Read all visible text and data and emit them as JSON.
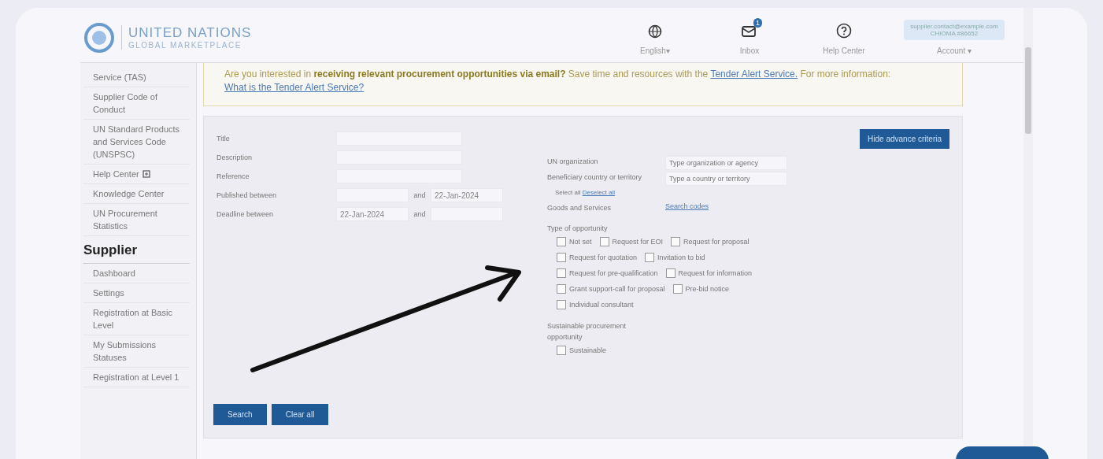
{
  "header": {
    "logo_title": "UNITED NATIONS",
    "logo_subtitle": "GLOBAL MARKETPLACE",
    "nav": [
      {
        "kind": "globe",
        "label": "English",
        "caret": "▾"
      },
      {
        "kind": "inbox",
        "label": "Inbox",
        "badge": "1"
      },
      {
        "kind": "help",
        "label": "Help Center"
      }
    ],
    "account": {
      "lines": [
        "supplier.contact@example.com",
        "CHIOMA #86652"
      ],
      "label": "Account",
      "caret": "▾"
    }
  },
  "sidebar": {
    "items": [
      {
        "label": "Service (TAS)",
        "kind": "link"
      },
      {
        "label": "Supplier Code of Conduct",
        "kind": "link"
      },
      {
        "label": "UN Standard Products and Services Code (UNSPSC)",
        "kind": "link"
      },
      {
        "label": "Help Center",
        "kind": "external"
      },
      {
        "label": "Knowledge Center",
        "kind": "link"
      },
      {
        "label": "UN Procurement Statistics",
        "kind": "link"
      },
      {
        "label": "Supplier",
        "kind": "heading"
      },
      {
        "label": "Dashboard",
        "kind": "link"
      },
      {
        "label": "Settings",
        "kind": "link"
      },
      {
        "label": "Registration at Basic Level",
        "kind": "link"
      },
      {
        "label": "My Submissions Statuses",
        "kind": "link"
      },
      {
        "label": "Registration at Level 1",
        "kind": "link"
      }
    ]
  },
  "banner": {
    "text": "Are you interested in **receiving relevant procurement opportunities via email?** Save time and resources with the",
    "link": "Tender Alert Service.",
    "after": "For more information:",
    "link2": "What is the Tender Alert Service?"
  },
  "form": {
    "fields": [
      {
        "label": "Title",
        "kind": "text"
      },
      {
        "label": "Description",
        "kind": "text"
      },
      {
        "label": "Reference",
        "kind": "text"
      },
      {
        "label": "Published between",
        "kind": "range",
        "and": "and",
        "to": "22-Jan-2024"
      },
      {
        "label": "Deadline between",
        "kind": "range",
        "from": "22-Jan-2024",
        "and": "and"
      }
    ],
    "hide_button": "Hide advance criteria",
    "organization": {
      "label": "UN organization",
      "placeholder": "Type organization or agency"
    },
    "country": {
      "label": "Beneficiary country or territory",
      "placeholder": "Type a country or territory",
      "note": "Select all",
      "note_link": "Deselect all"
    },
    "unspsc": {
      "label": "Goods and Services",
      "link": "Search codes"
    },
    "types": {
      "label": "Type of opportunity",
      "rows": [
        [
          {
            "label": "Not set",
            "checked": false
          },
          {
            "label": "Request for EOI",
            "checked": false
          },
          {
            "label": "Request for proposal",
            "checked": false
          }
        ],
        [
          {
            "label": "Request for quotation",
            "checked": false
          },
          {
            "label": "Invitation to bid",
            "checked": false
          }
        ],
        [
          {
            "label": "Request for pre-qualification",
            "checked": false
          },
          {
            "label": "Request for information",
            "checked": false
          }
        ],
        [
          {
            "label": "Grant support-call for proposal",
            "checked": false
          },
          {
            "label": "Pre-bid notice",
            "checked": false
          }
        ],
        [
          {
            "label": "Individual consultant",
            "checked": false
          }
        ]
      ]
    },
    "sustainable": {
      "label": "Sustainable procurement opportunity",
      "options": [
        {
          "label": "Sustainable",
          "checked": false
        }
      ]
    },
    "buttons": [
      "Search",
      "Clear all"
    ]
  }
}
